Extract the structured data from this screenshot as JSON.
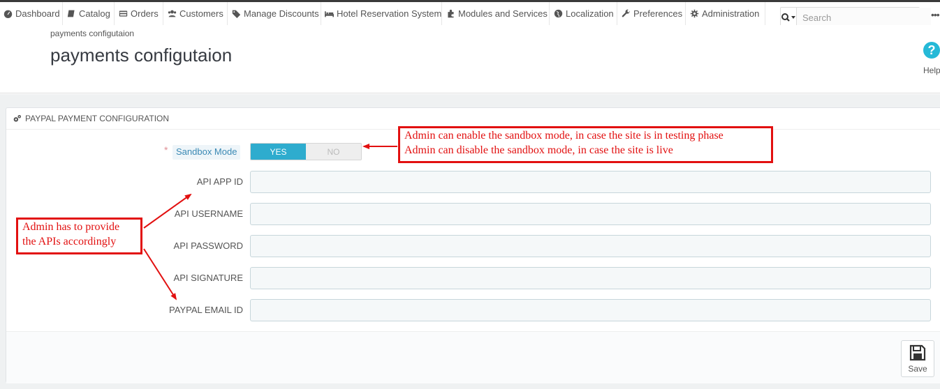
{
  "nav": {
    "items": [
      {
        "label": "Dashboard",
        "icon": "dashboard-icon"
      },
      {
        "label": "Catalog",
        "icon": "book-icon"
      },
      {
        "label": "Orders",
        "icon": "credit-card-icon"
      },
      {
        "label": "Customers",
        "icon": "users-icon"
      },
      {
        "label": "Manage Discounts",
        "icon": "tags-icon"
      },
      {
        "label": "Hotel Reservation System",
        "icon": "bed-icon"
      },
      {
        "label": "Modules and Services",
        "icon": "puzzle-icon"
      },
      {
        "label": "Localization",
        "icon": "globe-icon"
      },
      {
        "label": "Preferences",
        "icon": "wrench-icon"
      },
      {
        "label": "Administration",
        "icon": "gear-icon"
      }
    ],
    "search_placeholder": "Search",
    "more": "•••"
  },
  "header": {
    "breadcrumb": "payments configutaion",
    "title": "payments configutaion",
    "help_label": "Help"
  },
  "panel": {
    "title": "PAYPAL PAYMENT CONFIGURATION",
    "sandbox": {
      "required_mark": "*",
      "label": "Sandbox Mode",
      "yes": "YES",
      "no": "NO",
      "value": "YES"
    },
    "fields": [
      {
        "label": "API APP ID",
        "value": ""
      },
      {
        "label": "API USERNAME",
        "value": ""
      },
      {
        "label": "API PASSWORD",
        "value": ""
      },
      {
        "label": "API SIGNATURE",
        "value": ""
      },
      {
        "label": "PAYPAL EMAIL ID",
        "value": ""
      }
    ],
    "save_label": "Save"
  },
  "annotations": {
    "sandbox_note": [
      "Admin can enable the sandbox mode, in case the site is in testing phase",
      "Admin can disable the sandbox mode, in case the site is live"
    ],
    "api_note": [
      "Admin has to provide",
      "the APIs accordingly"
    ],
    "color": "#e21010"
  },
  "colors": {
    "switch_on": "#2eacce",
    "help_accent": "#25b9d7"
  }
}
